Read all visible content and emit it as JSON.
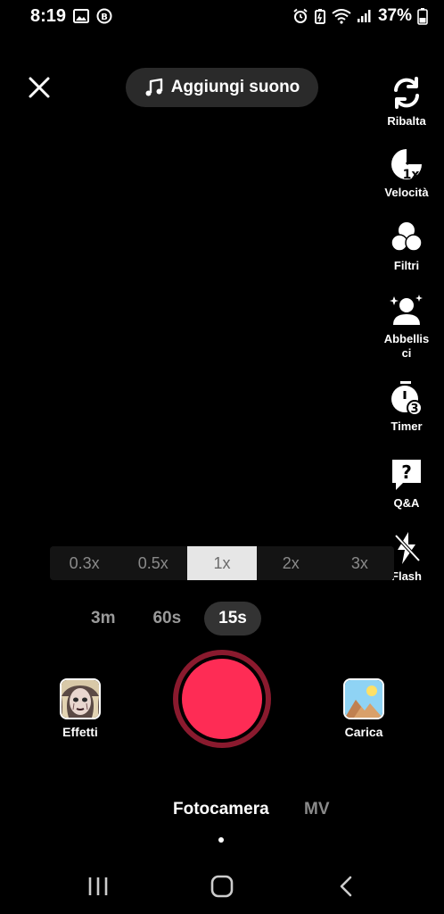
{
  "status_bar": {
    "time": "8:19",
    "battery_percent": "37%"
  },
  "top": {
    "sound_label": "Aggiungi suono"
  },
  "sidebar": {
    "items": [
      {
        "label": "Ribalta",
        "icon": "flip-camera-icon"
      },
      {
        "label": "Velocità",
        "icon": "speed-icon"
      },
      {
        "label": "Filtri",
        "icon": "filters-icon"
      },
      {
        "label": "Abbellisci",
        "icon": "beautify-icon"
      },
      {
        "label": "Timer",
        "icon": "timer-icon"
      },
      {
        "label": "Q&A",
        "icon": "qa-icon"
      },
      {
        "label": "Flash",
        "icon": "flash-off-icon"
      }
    ]
  },
  "speed": {
    "options": [
      "0.3x",
      "0.5x",
      "1x",
      "2x",
      "3x"
    ],
    "selected": "1x"
  },
  "duration": {
    "options": [
      "3m",
      "60s",
      "15s"
    ],
    "selected": "15s"
  },
  "effects_label": "Effetti",
  "upload_label": "Carica",
  "modes": {
    "photo": "Fotocamera",
    "mv": "MV"
  },
  "colors": {
    "record": "#fe2c55",
    "record_ring": "#8a1a2e",
    "background": "#000000"
  }
}
